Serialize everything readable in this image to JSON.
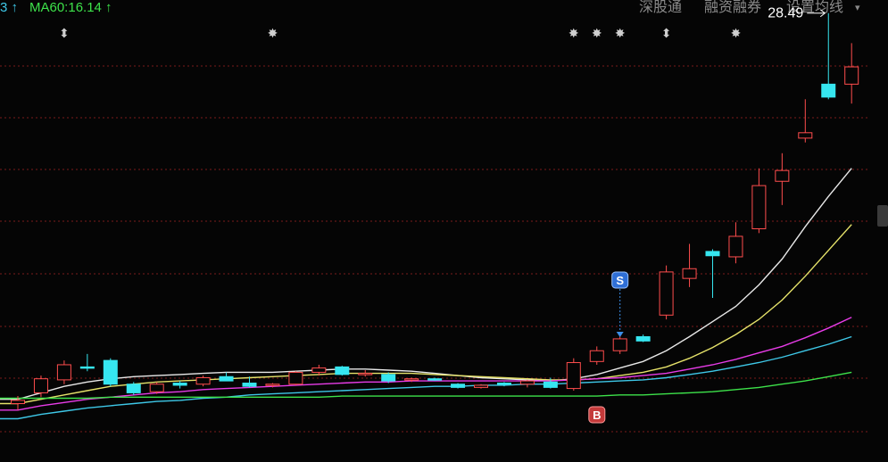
{
  "header": {
    "ma_left_fragment": "3 ↑",
    "ma60_text": "MA60:16.14 ↑",
    "menu": [
      "深股通",
      "融资融券",
      "设置均线"
    ],
    "caret": "▾"
  },
  "chart_data": {
    "type": "candlestick",
    "title": "",
    "xlabel": "",
    "ylabel": "",
    "grid": true,
    "annotations": {
      "max_label": "28.49",
      "buy_marker": "B",
      "sell_marker": "S",
      "event_marks": [
        "⬍",
        "✸",
        "✸",
        "✸",
        "✸",
        "⬍",
        "✸"
      ]
    },
    "candles": [
      {
        "o": 10.4,
        "h": 10.75,
        "l": 10.1,
        "c": 10.55
      },
      {
        "o": 10.9,
        "h": 11.7,
        "l": 10.7,
        "c": 11.55
      },
      {
        "o": 11.5,
        "h": 12.4,
        "l": 11.3,
        "c": 12.2
      },
      {
        "o": 12.1,
        "h": 12.7,
        "l": 11.9,
        "c": 12.05
      },
      {
        "o": 12.4,
        "h": 12.5,
        "l": 11.2,
        "c": 11.3
      },
      {
        "o": 11.3,
        "h": 11.4,
        "l": 10.8,
        "c": 10.9
      },
      {
        "o": 10.95,
        "h": 11.4,
        "l": 10.85,
        "c": 11.3
      },
      {
        "o": 11.35,
        "h": 11.45,
        "l": 11.1,
        "c": 11.25
      },
      {
        "o": 11.3,
        "h": 11.7,
        "l": 11.2,
        "c": 11.6
      },
      {
        "o": 11.65,
        "h": 11.85,
        "l": 11.45,
        "c": 11.45
      },
      {
        "o": 11.35,
        "h": 11.65,
        "l": 11.15,
        "c": 11.2
      },
      {
        "o": 11.25,
        "h": 11.35,
        "l": 11.15,
        "c": 11.3
      },
      {
        "o": 11.3,
        "h": 11.9,
        "l": 11.25,
        "c": 11.85
      },
      {
        "o": 11.85,
        "h": 12.2,
        "l": 11.7,
        "c": 12.05
      },
      {
        "o": 12.1,
        "h": 12.15,
        "l": 11.7,
        "c": 11.75
      },
      {
        "o": 11.75,
        "h": 11.95,
        "l": 11.65,
        "c": 11.8
      },
      {
        "o": 11.75,
        "h": 11.85,
        "l": 11.35,
        "c": 11.45
      },
      {
        "o": 11.5,
        "h": 11.6,
        "l": 11.4,
        "c": 11.55
      },
      {
        "o": 11.55,
        "h": 11.6,
        "l": 11.45,
        "c": 11.5
      },
      {
        "o": 11.3,
        "h": 11.35,
        "l": 11.1,
        "c": 11.15
      },
      {
        "o": 11.15,
        "h": 11.3,
        "l": 11.1,
        "c": 11.25
      },
      {
        "o": 11.35,
        "h": 11.4,
        "l": 11.2,
        "c": 11.3
      },
      {
        "o": 11.3,
        "h": 11.5,
        "l": 11.15,
        "c": 11.45
      },
      {
        "o": 11.4,
        "h": 11.6,
        "l": 11.1,
        "c": 11.15
      },
      {
        "o": 11.1,
        "h": 12.5,
        "l": 11.0,
        "c": 12.3
      },
      {
        "o": 12.35,
        "h": 13.05,
        "l": 12.2,
        "c": 12.85
      },
      {
        "o": 12.85,
        "h": 13.6,
        "l": 12.7,
        "c": 13.4
      },
      {
        "o": 13.5,
        "h": 13.6,
        "l": 13.25,
        "c": 13.3
      },
      {
        "o": 14.5,
        "h": 16.8,
        "l": 14.3,
        "c": 16.5
      },
      {
        "o": 16.2,
        "h": 17.8,
        "l": 15.8,
        "c": 16.65
      },
      {
        "o": 17.45,
        "h": 17.55,
        "l": 15.3,
        "c": 17.25
      },
      {
        "o": 17.2,
        "h": 18.8,
        "l": 16.9,
        "c": 18.15
      },
      {
        "o": 18.5,
        "h": 21.3,
        "l": 18.3,
        "c": 20.5
      },
      {
        "o": 20.7,
        "h": 22.0,
        "l": 19.6,
        "c": 21.2
      },
      {
        "o": 22.7,
        "h": 24.5,
        "l": 22.5,
        "c": 22.95
      },
      {
        "o": 25.2,
        "h": 28.49,
        "l": 24.5,
        "c": 24.6
      },
      {
        "o": 25.2,
        "h": 27.1,
        "l": 24.3,
        "c": 26.0
      }
    ],
    "ma_lines": [
      {
        "color": "#e8e8e8",
        "values": [
          10.6,
          10.9,
          11.2,
          11.4,
          11.55,
          11.65,
          11.7,
          11.75,
          11.8,
          11.85,
          11.85,
          11.85,
          11.9,
          11.95,
          12.0,
          12.0,
          11.95,
          11.9,
          11.8,
          11.7,
          11.6,
          11.55,
          11.5,
          11.45,
          11.55,
          11.75,
          12.05,
          12.35,
          12.85,
          13.5,
          14.2,
          14.9,
          15.9,
          17.1,
          18.6,
          20.0,
          21.3
        ]
      },
      {
        "color": "#e6e36a",
        "values": [
          10.4,
          10.6,
          10.8,
          11.0,
          11.2,
          11.3,
          11.4,
          11.45,
          11.5,
          11.55,
          11.6,
          11.65,
          11.7,
          11.75,
          11.8,
          11.8,
          11.8,
          11.8,
          11.75,
          11.7,
          11.65,
          11.6,
          11.55,
          11.5,
          11.5,
          11.55,
          11.7,
          11.85,
          12.1,
          12.5,
          13.0,
          13.6,
          14.3,
          15.2,
          16.3,
          17.5,
          18.7
        ]
      },
      {
        "color": "#e83ce8",
        "values": [
          10.1,
          10.3,
          10.45,
          10.6,
          10.7,
          10.8,
          10.9,
          10.95,
          11.05,
          11.1,
          11.15,
          11.2,
          11.25,
          11.3,
          11.35,
          11.4,
          11.4,
          11.45,
          11.45,
          11.45,
          11.45,
          11.45,
          11.45,
          11.45,
          11.5,
          11.55,
          11.6,
          11.7,
          11.8,
          12.0,
          12.2,
          12.45,
          12.75,
          13.05,
          13.45,
          13.9,
          14.4
        ]
      },
      {
        "color": "#3ec8e8",
        "values": [
          9.7,
          9.9,
          10.05,
          10.2,
          10.3,
          10.4,
          10.5,
          10.55,
          10.65,
          10.7,
          10.8,
          10.85,
          10.9,
          10.95,
          11.0,
          11.05,
          11.1,
          11.15,
          11.2,
          11.2,
          11.25,
          11.25,
          11.3,
          11.3,
          11.35,
          11.4,
          11.45,
          11.5,
          11.6,
          11.75,
          11.9,
          12.1,
          12.3,
          12.55,
          12.85,
          13.15,
          13.5
        ]
      },
      {
        "color": "#3de24a",
        "values": [
          10.65,
          10.65,
          10.65,
          10.65,
          10.7,
          10.7,
          10.7,
          10.7,
          10.7,
          10.7,
          10.7,
          10.7,
          10.7,
          10.7,
          10.75,
          10.75,
          10.75,
          10.75,
          10.75,
          10.75,
          10.75,
          10.75,
          10.75,
          10.75,
          10.75,
          10.75,
          10.8,
          10.8,
          10.85,
          10.9,
          10.95,
          11.05,
          11.15,
          11.3,
          11.45,
          11.65,
          11.85
        ]
      }
    ]
  }
}
